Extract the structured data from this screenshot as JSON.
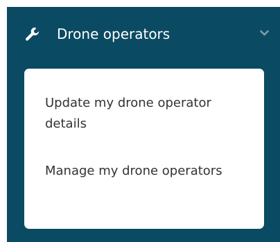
{
  "panel": {
    "title": "Drone operators",
    "icon": "wrench-icon",
    "toggle_icon": "chevron-down-icon",
    "colors": {
      "panel_background": "#0b4a63",
      "title_text": "#ffffff",
      "chevron": "#7b9eab",
      "menu_background": "#ffffff",
      "menu_text": "#333333"
    }
  },
  "menu": {
    "items": [
      {
        "label": "Update my drone operator details"
      },
      {
        "label": "Manage my drone operators"
      }
    ]
  }
}
